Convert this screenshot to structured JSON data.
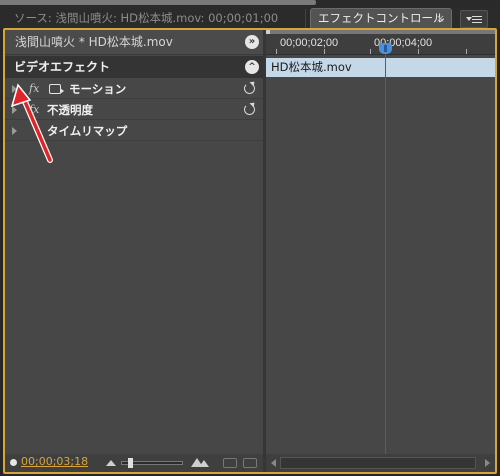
{
  "tabs": {
    "source": "ソース: 浅間山噴火: HD松本城.mov: 00;00;01;00",
    "effect_controls": "エフェクトコントロール",
    "close_glyph": "×"
  },
  "header": {
    "sequence_clip": "浅間山噴火 * HD松本城.mov",
    "expand_glyph": "»"
  },
  "section": {
    "title": "ビデオエフェクト",
    "collapse_glyph": "^"
  },
  "effects": [
    {
      "fx": "fx",
      "label": "モーション"
    },
    {
      "fx": "fx",
      "label": "不透明度"
    },
    {
      "fx": "",
      "label": "タイムリマップ"
    }
  ],
  "timeline": {
    "tick1": "00;00;02;00",
    "tick2": "00;00;04;00",
    "clip_name": "HD松本城.mov"
  },
  "footer": {
    "timecode": "00;00;03;18"
  },
  "colors": {
    "panel_highlight": "#d7a53a",
    "playhead": "#e0242a",
    "clip_bg": "#c5d8e8",
    "annotation_arrow": "#e0242a"
  }
}
